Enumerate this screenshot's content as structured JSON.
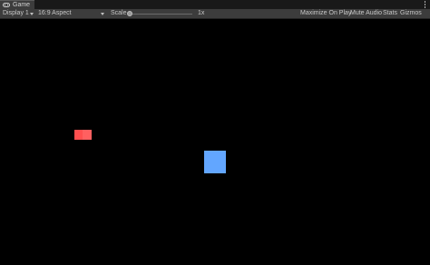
{
  "tab": {
    "label": "Game",
    "icon": "gamepad-icon"
  },
  "toolbar": {
    "display": "Display 1",
    "aspect": "16:9 Aspect",
    "scale_label": "Scale",
    "scale_value": "1x",
    "maximize": "Maximize On Play",
    "mute": "Mute Audio",
    "stats": "Stats",
    "gizmos": "Gizmos"
  },
  "scene": {
    "red_color": "#ff4f4f",
    "blue_color": "#62a6ff"
  }
}
